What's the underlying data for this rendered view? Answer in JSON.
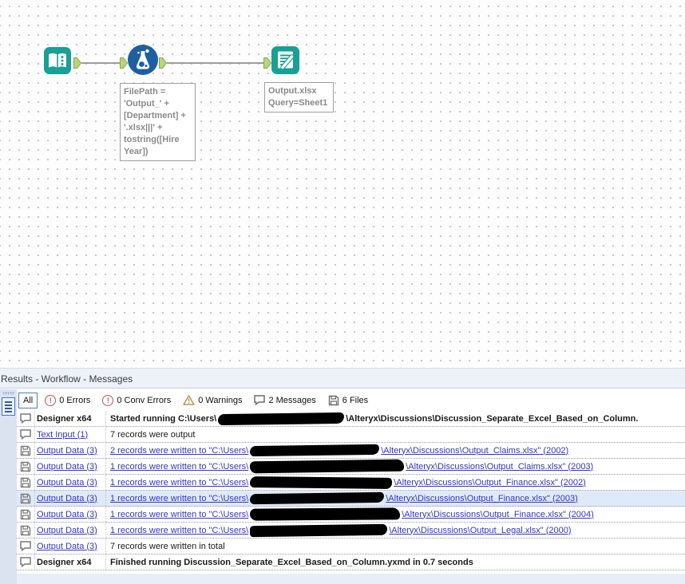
{
  "colors": {
    "tool_teal": "#17a095",
    "formula_blue": "#1d5fa0",
    "anchor_green": "#b5d775",
    "link_blue": "#3434cf",
    "error_red": "#c0544f",
    "warning_tan": "#bd9355",
    "row_highlight": "#dfeaf8",
    "panel_bg": "#edf1f8"
  },
  "canvas": {
    "tools": [
      {
        "name": "Text Input",
        "type": "text-input"
      },
      {
        "name": "Formula",
        "type": "formula",
        "annotation": "FilePath =\n'Output_' +\n[Department] +\n'.xlsx|||' +\ntostring([Hire\nYear])"
      },
      {
        "name": "Output Data",
        "type": "output-data",
        "annotation": "Output.xlsx\nQuery=Sheet1"
      }
    ]
  },
  "results": {
    "title": "Results - Workflow - Messages",
    "toolbar": {
      "all": "All",
      "errors": "0 Errors",
      "conv_errors": "0 Conv Errors",
      "warnings": "0 Warnings",
      "messages": "2 Messages",
      "files": "6 Files"
    },
    "rows": [
      {
        "icon": "message",
        "tool": "Designer x64",
        "prefix": "Started running C:\\Users\\",
        "suffix": "\\Alteryx\\Discussions\\Discussion_Separate_Excel_Based_on_Column."
      },
      {
        "icon": "message",
        "tool": "Text Input (1)",
        "prefix": "7 records were output",
        "suffix": ""
      },
      {
        "icon": "file",
        "tool": "Output Data (3)",
        "prefix": "2 records were written to \"C:\\Users\\",
        "suffix": "\\Alteryx\\Discussions\\Output_Claims.xlsx\" (2002)"
      },
      {
        "icon": "file",
        "tool": "Output Data (3)",
        "prefix": "1 records were written to \"C:\\Users\\",
        "suffix": "\\Alteryx\\Discussions\\Output_Claims.xlsx\" (2003)"
      },
      {
        "icon": "file",
        "tool": "Output Data (3)",
        "prefix": "1 records were written to \"C:\\Users\\",
        "suffix": "\\Alteryx\\Discussions\\Output_Finance.xlsx\" (2002)"
      },
      {
        "icon": "file",
        "tool": "Output Data (3)",
        "prefix": "1 records were written to \"C:\\Users\\",
        "suffix": "\\Alteryx\\Discussions\\Output_Finance.xlsx\" (2003)"
      },
      {
        "icon": "file",
        "tool": "Output Data (3)",
        "prefix": "1 records were written to \"C:\\Users\\",
        "suffix": "\\Alteryx\\Discussions\\Output_Finance.xlsx\" (2004)"
      },
      {
        "icon": "file",
        "tool": "Output Data (3)",
        "prefix": "1 records were written to \"C:\\Users\\",
        "suffix": "\\Alteryx\\Discussions\\Output_Legal.xlsx\" (2000)"
      },
      {
        "icon": "message",
        "tool": "Output Data (3)",
        "prefix": "7 records were written in total",
        "suffix": ""
      },
      {
        "icon": "message",
        "tool": "Designer x64",
        "prefix": "Finished running Discussion_Separate_Excel_Based_on_Column.yxmd in 0.7 seconds",
        "suffix": ""
      }
    ]
  }
}
